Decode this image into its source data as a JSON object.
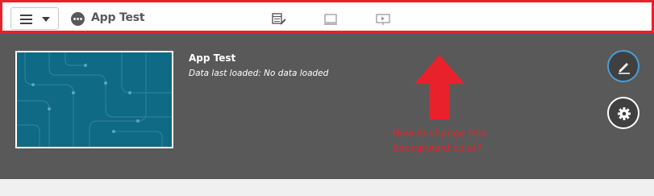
{
  "toolbar": {
    "app_title": "App Test",
    "border_color": "#e8212b",
    "icons": [
      "hamburger-menu-icon",
      "chevron-down-icon",
      "app-options-icon",
      "data-manager-icon",
      "analysis-icon",
      "storytelling-icon"
    ]
  },
  "hero": {
    "title": "App Test",
    "subtitle": "Data last loaded: No data loaded",
    "background_color": "#595959",
    "thumbnail_color": "#0e6a85",
    "buttons": [
      "edit-icon",
      "gear-icon"
    ]
  },
  "annotation": {
    "text": "How to change this background color?",
    "color": "#e8212b"
  }
}
